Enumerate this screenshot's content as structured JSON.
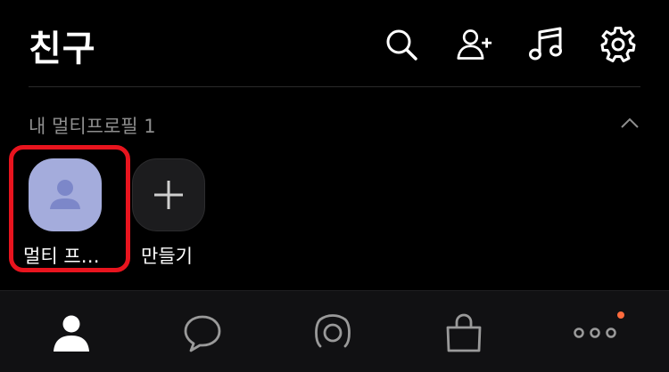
{
  "header": {
    "title": "친구",
    "icons": [
      "search-icon",
      "add-friend-icon",
      "music-icon",
      "settings-icon"
    ]
  },
  "section": {
    "label": "내 멀티프로필 1"
  },
  "profiles": {
    "items": [
      {
        "name": "멀티 프…",
        "avatar_color": "#a4acdc"
      }
    ],
    "create_label": "만들기"
  },
  "tabbar": {
    "tabs": [
      "friends-tab-icon",
      "chats-tab-icon",
      "openchat-tab-icon",
      "shopping-tab-icon",
      "more-tab-icon"
    ],
    "badge_color": "#ff6b3d"
  },
  "colors": {
    "background": "#000000",
    "highlight_border": "#e8141e",
    "secondary_text": "#8e8e8e"
  }
}
